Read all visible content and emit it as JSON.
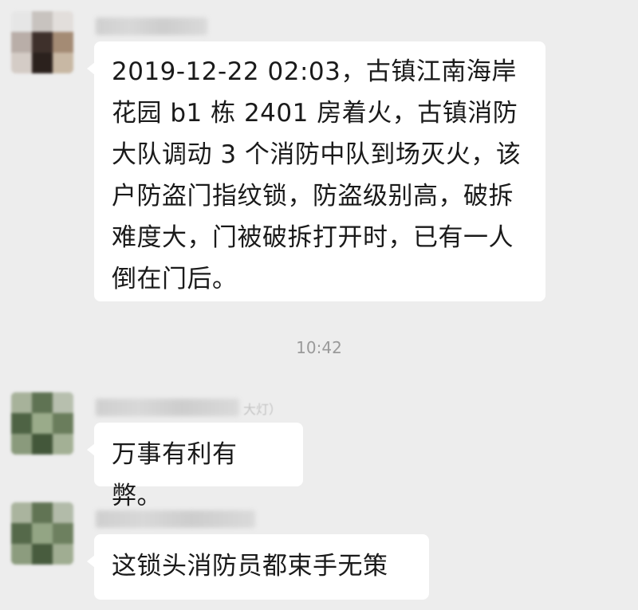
{
  "messages": [
    {
      "sender_name": "",
      "text": "2019-12-22 02:03，古镇江南海岸花园 b1 栋 2401 房着火，古镇消防大队调动 3 个消防中队到场灭火，该户防盗门指纹锁，防盗级别高，破拆难度大，门被破拆打开时，已有一人倒在门后。"
    },
    {
      "sender_name_visible_tail": "大灯）",
      "text": "万事有利有弊。"
    },
    {
      "sender_name": "",
      "text": "这锁头消防员都束手无策"
    }
  ],
  "timestamp": "10:42",
  "colors": {
    "background": "#ededed",
    "bubble": "#ffffff",
    "text": "#1a1a1a",
    "timestamp": "#9a9a9a"
  }
}
